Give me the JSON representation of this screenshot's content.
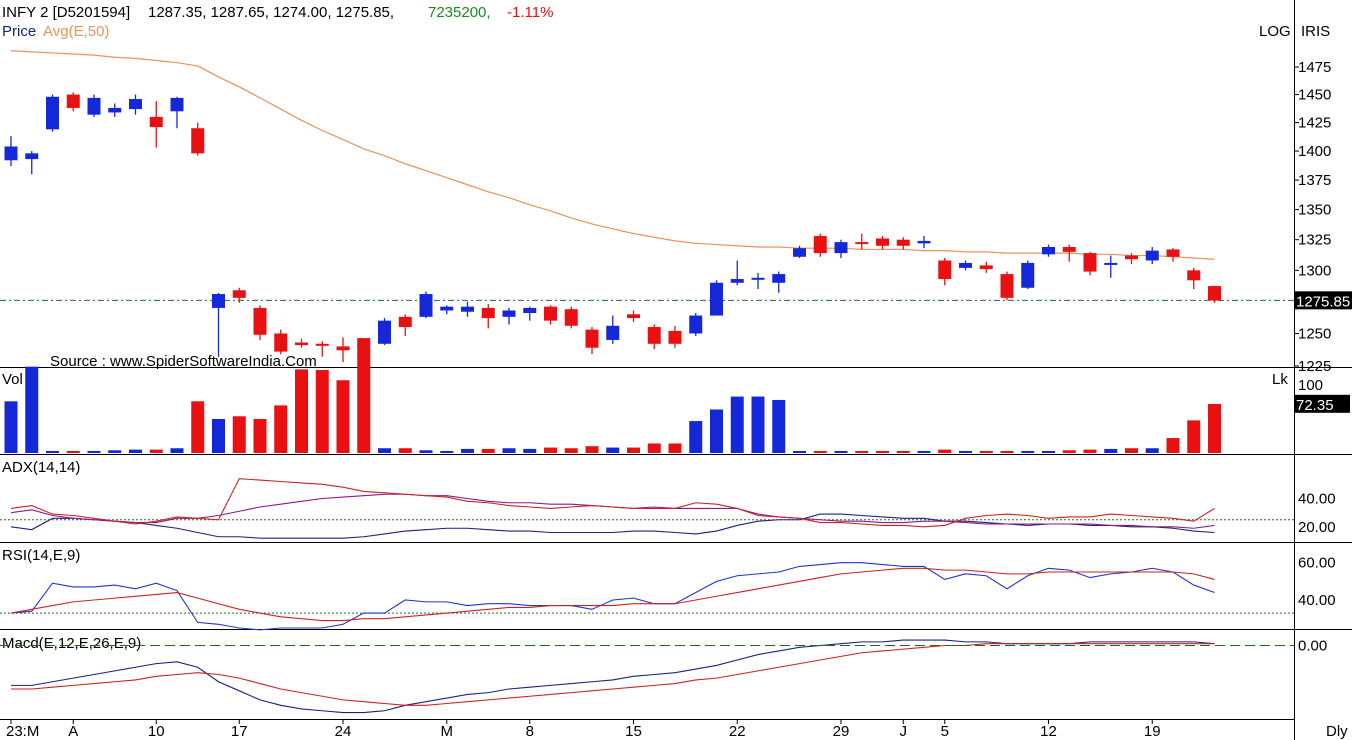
{
  "header": {
    "symbol": "INFY 2 [D5201594]",
    "ohlc": "1287.35, 1287.65, 1274.00, 1275.85,",
    "volume": "7235200,",
    "change": "-1.11%",
    "legend_price": "Price",
    "legend_avg": "Avg(E,50)",
    "log_label": "LOG",
    "iris_label": "IRIS",
    "source": "Source : www.SpiderSoftwareIndia.Com"
  },
  "colors": {
    "up": "#1528d9",
    "down": "#e81010",
    "avg": "#e8925c",
    "adx": "#1a237e",
    "di_plus": "#8b1a8b",
    "di_minus": "#cc2222",
    "rsi": "#2233cc",
    "rsi_avg": "#cc2222",
    "macd": "#1a237e",
    "signal": "#cc2222"
  },
  "chart_data": [
    {
      "type": "candlestick",
      "panel": "price",
      "scale": "log",
      "ylim": [
        1225,
        1500
      ],
      "y_ticks": [
        1225,
        1250,
        1275,
        1300,
        1325,
        1350,
        1375,
        1400,
        1425,
        1450,
        1475
      ],
      "last_price_label": "1275.85",
      "reference_line": 1276,
      "x_ticks": [
        "23:M",
        "A",
        "10",
        "17",
        "24",
        "M",
        "8",
        "15",
        "22",
        "29",
        "J",
        "5",
        "12",
        "19"
      ],
      "x_tick_index": [
        0,
        3,
        7,
        11,
        16,
        21,
        25,
        30,
        35,
        40,
        43,
        45,
        50,
        55
      ],
      "x_end_label": "Dly",
      "candles": [
        {
          "o": 1392,
          "h": 1413,
          "l": 1387,
          "c": 1404
        },
        {
          "o": 1393,
          "h": 1400,
          "l": 1380,
          "c": 1398
        },
        {
          "o": 1419,
          "h": 1450,
          "l": 1417,
          "c": 1448
        },
        {
          "o": 1450,
          "h": 1452,
          "l": 1435,
          "c": 1438
        },
        {
          "o": 1432,
          "h": 1450,
          "l": 1430,
          "c": 1447
        },
        {
          "o": 1434,
          "h": 1442,
          "l": 1430,
          "c": 1438
        },
        {
          "o": 1437,
          "h": 1450,
          "l": 1432,
          "c": 1446
        },
        {
          "o": 1430,
          "h": 1444,
          "l": 1403,
          "c": 1421
        },
        {
          "o": 1435,
          "h": 1448,
          "l": 1420,
          "c": 1447
        },
        {
          "o": 1420,
          "h": 1425,
          "l": 1396,
          "c": 1398
        },
        {
          "o": 1270,
          "h": 1282,
          "l": 1232,
          "c": 1281
        },
        {
          "o": 1284,
          "h": 1286,
          "l": 1274,
          "c": 1278
        },
        {
          "o": 1270,
          "h": 1272,
          "l": 1245,
          "c": 1249
        },
        {
          "o": 1250,
          "h": 1253,
          "l": 1234,
          "c": 1236
        },
        {
          "o": 1243,
          "h": 1246,
          "l": 1239,
          "c": 1241
        },
        {
          "o": 1242,
          "h": 1244,
          "l": 1232,
          "c": 1241
        },
        {
          "o": 1240,
          "h": 1247,
          "l": 1228,
          "c": 1237
        },
        {
          "o": 1242,
          "h": 1245,
          "l": 1237,
          "c": 1241
        },
        {
          "o": 1242,
          "h": 1262,
          "l": 1241,
          "c": 1260
        },
        {
          "o": 1263,
          "h": 1265,
          "l": 1248,
          "c": 1255
        },
        {
          "o": 1263,
          "h": 1283,
          "l": 1262,
          "c": 1281
        },
        {
          "o": 1268,
          "h": 1272,
          "l": 1265,
          "c": 1271
        },
        {
          "o": 1267,
          "h": 1275,
          "l": 1263,
          "c": 1271
        },
        {
          "o": 1270,
          "h": 1273,
          "l": 1254,
          "c": 1262
        },
        {
          "o": 1263,
          "h": 1270,
          "l": 1257,
          "c": 1268
        },
        {
          "o": 1266,
          "h": 1271,
          "l": 1260,
          "c": 1270
        },
        {
          "o": 1271,
          "h": 1272,
          "l": 1257,
          "c": 1260
        },
        {
          "o": 1269,
          "h": 1271,
          "l": 1254,
          "c": 1256
        },
        {
          "o": 1253,
          "h": 1255,
          "l": 1234,
          "c": 1239
        },
        {
          "o": 1245,
          "h": 1264,
          "l": 1242,
          "c": 1256
        },
        {
          "o": 1265,
          "h": 1268,
          "l": 1259,
          "c": 1262
        },
        {
          "o": 1255,
          "h": 1257,
          "l": 1238,
          "c": 1242
        },
        {
          "o": 1252,
          "h": 1256,
          "l": 1239,
          "c": 1242
        },
        {
          "o": 1250,
          "h": 1266,
          "l": 1248,
          "c": 1264
        },
        {
          "o": 1264,
          "h": 1292,
          "l": 1264,
          "c": 1290
        },
        {
          "o": 1290,
          "h": 1308,
          "l": 1288,
          "c": 1293
        },
        {
          "o": 1293,
          "h": 1298,
          "l": 1285,
          "c": 1294
        },
        {
          "o": 1290,
          "h": 1299,
          "l": 1282,
          "c": 1297
        },
        {
          "o": 1311,
          "h": 1320,
          "l": 1310,
          "c": 1318
        },
        {
          "o": 1328,
          "h": 1330,
          "l": 1311,
          "c": 1314
        },
        {
          "o": 1314,
          "h": 1325,
          "l": 1310,
          "c": 1323
        },
        {
          "o": 1323,
          "h": 1330,
          "l": 1317,
          "c": 1322
        },
        {
          "o": 1326,
          "h": 1328,
          "l": 1317,
          "c": 1320
        },
        {
          "o": 1325,
          "h": 1327,
          "l": 1317,
          "c": 1320
        },
        {
          "o": 1322,
          "h": 1328,
          "l": 1318,
          "c": 1324
        },
        {
          "o": 1308,
          "h": 1310,
          "l": 1288,
          "c": 1293
        },
        {
          "o": 1302,
          "h": 1308,
          "l": 1300,
          "c": 1306
        },
        {
          "o": 1304,
          "h": 1307,
          "l": 1298,
          "c": 1301
        },
        {
          "o": 1297,
          "h": 1299,
          "l": 1276,
          "c": 1278
        },
        {
          "o": 1286,
          "h": 1308,
          "l": 1285,
          "c": 1306
        },
        {
          "o": 1313,
          "h": 1321,
          "l": 1311,
          "c": 1319
        },
        {
          "o": 1319,
          "h": 1321,
          "l": 1307,
          "c": 1315
        },
        {
          "o": 1314,
          "h": 1315,
          "l": 1296,
          "c": 1299
        },
        {
          "o": 1306,
          "h": 1312,
          "l": 1294,
          "c": 1306
        },
        {
          "o": 1312,
          "h": 1314,
          "l": 1305,
          "c": 1309
        },
        {
          "o": 1308,
          "h": 1319,
          "l": 1305,
          "c": 1316
        },
        {
          "o": 1317,
          "h": 1318,
          "l": 1307,
          "c": 1311
        },
        {
          "o": 1300,
          "h": 1302,
          "l": 1285,
          "c": 1292
        },
        {
          "o": 1287.35,
          "h": 1287.65,
          "l": 1274.0,
          "c": 1275.85
        }
      ],
      "series": [
        {
          "name": "Avg(E,50)",
          "values": [
            1490,
            1489,
            1488,
            1487,
            1486,
            1484,
            1483,
            1481,
            1479,
            1476,
            1466,
            1457,
            1447,
            1437,
            1427,
            1418,
            1410,
            1402,
            1396,
            1389,
            1383,
            1377,
            1371,
            1365,
            1360,
            1354,
            1349,
            1343,
            1338,
            1334,
            1330,
            1327,
            1324,
            1322,
            1321,
            1320,
            1319,
            1319,
            1318,
            1318,
            1318,
            1317,
            1317,
            1317,
            1316,
            1316,
            1315,
            1315,
            1314,
            1314,
            1314,
            1314,
            1313,
            1313,
            1312,
            1312,
            1311,
            1310,
            1309
          ]
        }
      ]
    },
    {
      "type": "bar",
      "panel": "volume",
      "title": "Vol",
      "unit": "Lk",
      "y_ticks": [
        100
      ],
      "ylim": [
        0,
        125
      ],
      "last_value_label": "72.35",
      "values": [
        76,
        127,
        3,
        3,
        3,
        4,
        5,
        5,
        7,
        76,
        50,
        54,
        50,
        70,
        123,
        122,
        107,
        169,
        7,
        7,
        4,
        3,
        6,
        6,
        7,
        6,
        8,
        7,
        10,
        8,
        8,
        14,
        14,
        47,
        64,
        83,
        83,
        78,
        3,
        3,
        3,
        3,
        3,
        3,
        3,
        5,
        3,
        3,
        3,
        3,
        3,
        4,
        5,
        6,
        7,
        7,
        22,
        48,
        72
      ]
    },
    {
      "type": "line",
      "panel": "ADX(14,14)",
      "title": "ADX(14,14)",
      "ylim": [
        10,
        70
      ],
      "y_ticks": [
        20,
        40
      ],
      "y_tick_labels": [
        "20.00",
        "40.00"
      ],
      "reference_line": 25,
      "series": [
        {
          "name": "ADX",
          "values": [
            20,
            18,
            26,
            26,
            25,
            24,
            23,
            21,
            19,
            16,
            13,
            13,
            12,
            12,
            12,
            12,
            12,
            13,
            15,
            17,
            18,
            19,
            19,
            18,
            17,
            17,
            16,
            16,
            16,
            16,
            17,
            17,
            16,
            15,
            17,
            21,
            24,
            25,
            25,
            29,
            29,
            28,
            27,
            26,
            26,
            24,
            24,
            23,
            22,
            21,
            22,
            22,
            21,
            21,
            20,
            20,
            19,
            17,
            16
          ]
        },
        {
          "name": "DI+",
          "values": [
            30,
            32,
            28,
            26,
            25,
            24,
            23,
            23,
            26,
            26,
            28,
            31,
            34,
            36,
            38,
            40,
            41,
            42,
            43,
            43,
            42,
            42,
            40,
            38,
            37,
            37,
            36,
            36,
            35,
            34,
            33,
            34,
            33,
            33,
            33,
            33,
            29,
            27,
            26,
            25,
            24,
            24,
            23,
            23,
            24,
            24,
            23,
            22,
            22,
            22,
            22,
            22,
            22,
            21,
            21,
            20,
            20,
            19,
            21
          ]
        },
        {
          "name": "DI-",
          "values": [
            33,
            35,
            29,
            28,
            26,
            24,
            22,
            24,
            27,
            26,
            25,
            54,
            53,
            52,
            51,
            50,
            48,
            45,
            44,
            43,
            42,
            41,
            38,
            37,
            35,
            34,
            33,
            34,
            35,
            34,
            33,
            33,
            33,
            37,
            36,
            33,
            28,
            27,
            26,
            23,
            23,
            22,
            21,
            21,
            20,
            21,
            26,
            28,
            29,
            28,
            26,
            27,
            27,
            29,
            28,
            27,
            26,
            24,
            33
          ]
        }
      ]
    },
    {
      "type": "line",
      "panel": "RSI(14,E,9)",
      "title": "RSI(14,E,9)",
      "ylim": [
        25,
        70
      ],
      "y_ticks": [
        40,
        60
      ],
      "y_tick_labels": [
        "40.00",
        "60.00"
      ],
      "reference_line": 33,
      "series": [
        {
          "name": "RSI",
          "values": [
            33,
            34,
            49,
            47,
            47,
            48,
            46,
            49,
            45,
            28,
            27,
            25,
            24,
            25,
            25,
            25,
            27,
            33,
            33,
            40,
            39,
            39,
            37,
            38,
            38,
            37,
            37,
            37,
            35,
            40,
            41,
            38,
            38,
            44,
            50,
            53,
            54,
            55,
            58,
            59,
            60,
            60,
            59,
            58,
            58,
            51,
            54,
            53,
            46,
            53,
            57,
            56,
            52,
            54,
            55,
            57,
            55,
            48,
            44
          ]
        },
        {
          "name": "RSI Avg",
          "values": [
            33,
            35,
            37,
            39,
            40,
            41,
            42,
            43,
            44,
            41,
            38,
            35,
            33,
            31,
            30,
            29,
            29,
            30,
            30,
            31,
            32,
            33,
            34,
            35,
            36,
            36,
            37,
            37,
            37,
            37,
            38,
            38,
            38,
            40,
            42,
            44,
            46,
            48,
            50,
            52,
            54,
            55,
            56,
            57,
            57,
            56,
            56,
            55,
            54,
            54,
            55,
            55,
            55,
            55,
            55,
            55,
            55,
            54,
            51
          ]
        }
      ]
    },
    {
      "type": "line",
      "panel": "Macd(E,12,E,26,E,9)",
      "title": "Macd(E,12,E,26,E,9)",
      "ylim": [
        -40,
        8
      ],
      "y_ticks": [
        0
      ],
      "y_tick_labels": [
        "0.00"
      ],
      "series": [
        {
          "name": "MACD",
          "values": [
            -22,
            -22,
            -20,
            -18,
            -16,
            -14,
            -12,
            -10,
            -9,
            -12,
            -20,
            -25,
            -30,
            -33,
            -35,
            -36,
            -37,
            -37,
            -36,
            -33,
            -31,
            -29,
            -27,
            -26,
            -24,
            -23,
            -22,
            -21,
            -20,
            -19,
            -17,
            -16,
            -15,
            -13,
            -11,
            -8,
            -5,
            -3,
            -1,
            0,
            1,
            2,
            2,
            3,
            3,
            3,
            2,
            2,
            1,
            1,
            1,
            1,
            2,
            2,
            2,
            2,
            2,
            2,
            1
          ]
        },
        {
          "name": "Signal",
          "values": [
            -24,
            -24,
            -23,
            -22,
            -21,
            -20,
            -19,
            -17,
            -16,
            -15,
            -16,
            -18,
            -21,
            -24,
            -26,
            -28,
            -30,
            -31,
            -32,
            -33,
            -33,
            -32,
            -31,
            -30,
            -29,
            -28,
            -27,
            -26,
            -25,
            -24,
            -23,
            -22,
            -21,
            -19,
            -18,
            -16,
            -14,
            -12,
            -10,
            -8,
            -6,
            -4,
            -3,
            -2,
            -1,
            0,
            0,
            1,
            1,
            1,
            1,
            1,
            1,
            1,
            1,
            1,
            1,
            1,
            1
          ]
        }
      ]
    }
  ]
}
